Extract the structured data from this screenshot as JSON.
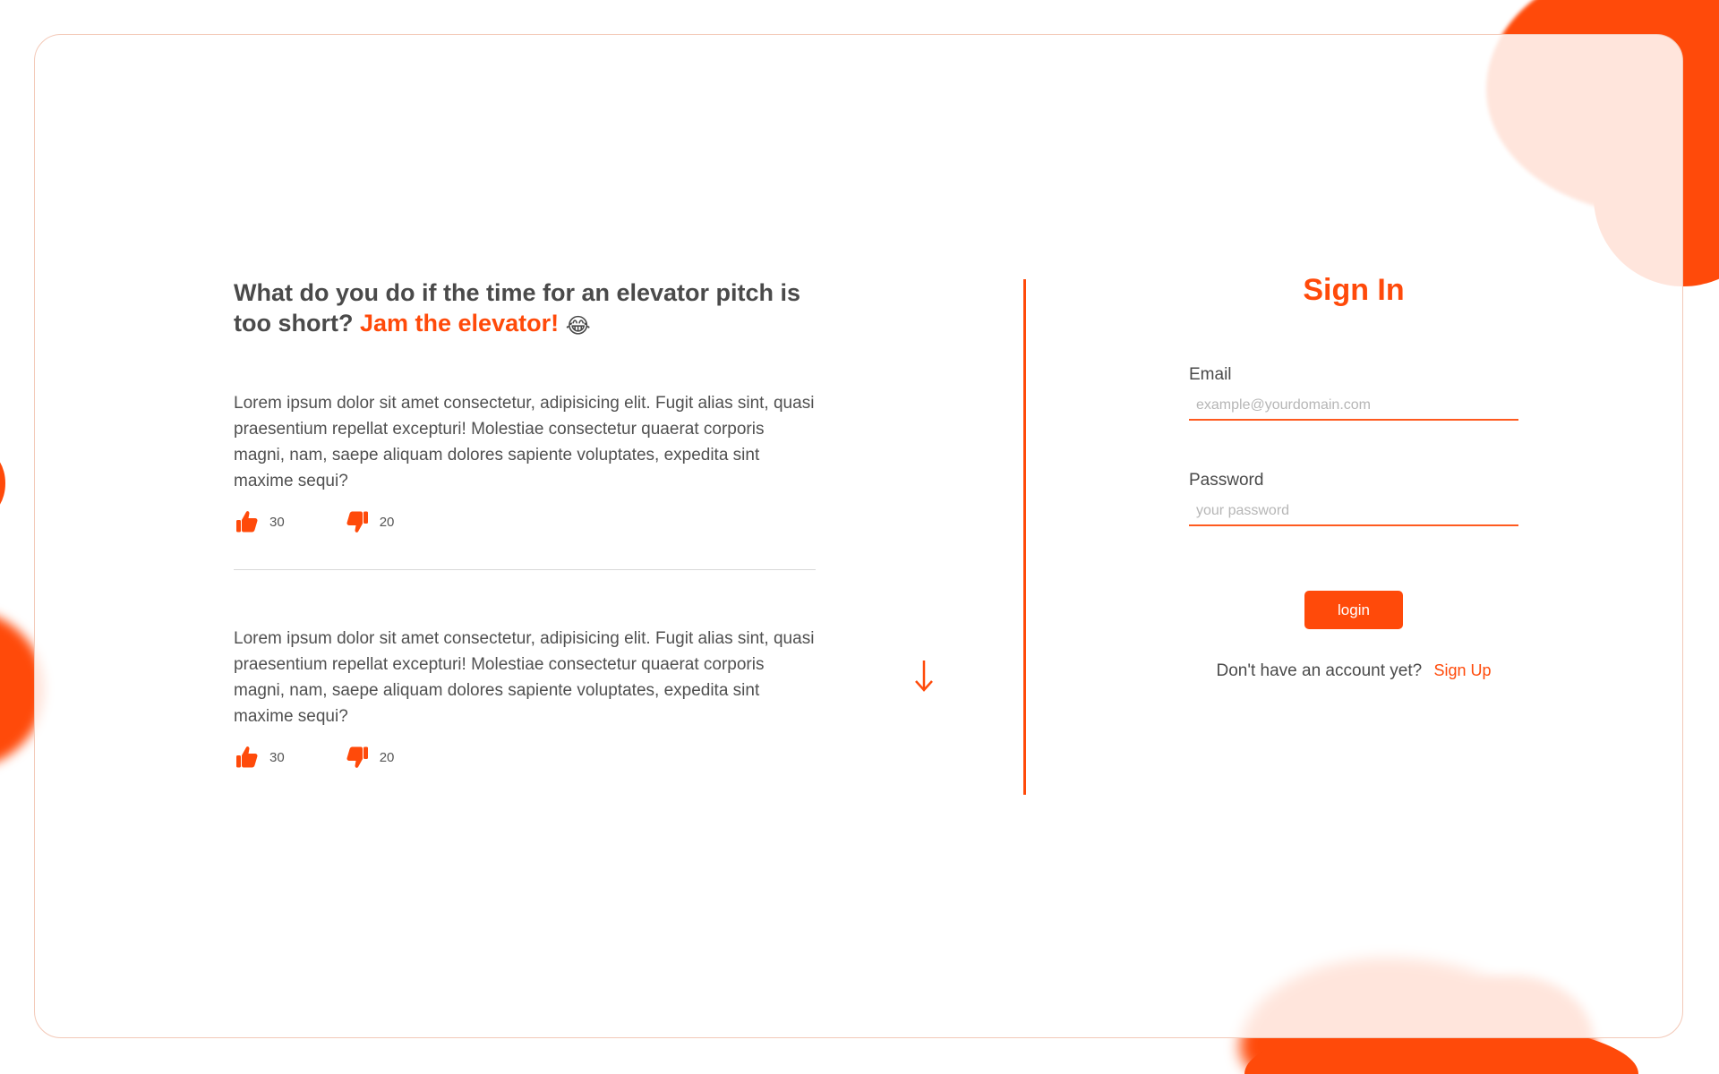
{
  "colors": {
    "accent": "#ff4a0a",
    "text": "#4a4a4a",
    "card_border": "#f3c9b8",
    "divider": "#d9d9d9"
  },
  "pitch": {
    "headline_main": "What do you do if the time for an elevator pitch is too short?",
    "headline_accent": "Jam the elevator!",
    "headline_emoji": "😂"
  },
  "posts": [
    {
      "text": "Lorem ipsum dolor sit amet consectetur, adipisicing elit. Fugit alias sint, quasi praesentium repellat excepturi! Molestiae consectetur quaerat corporis magni, nam, saepe aliquam dolores sapiente voluptates, expedita sint maxime sequi?",
      "likes": "30",
      "dislikes": "20"
    },
    {
      "text": "Lorem ipsum dolor sit amet consectetur, adipisicing elit. Fugit alias sint, quasi praesentium repellat excepturi! Molestiae consectetur quaerat corporis magni, nam, saepe aliquam dolores sapiente voluptates, expedita sint maxime sequi?",
      "likes": "30",
      "dislikes": "20"
    }
  ],
  "icons": {
    "like": "thumbs-up-icon",
    "dislike": "thumbs-down-icon",
    "scroll": "arrow-down-icon"
  },
  "signin": {
    "title": "Sign In",
    "email_label": "Email",
    "email_placeholder": "example@yourdomain.com",
    "email_value": "",
    "password_label": "Password",
    "password_placeholder": "your password",
    "password_value": "",
    "login_label": "login",
    "no_account_text": "Don't have an account yet?",
    "signup_label": "Sign Up"
  }
}
